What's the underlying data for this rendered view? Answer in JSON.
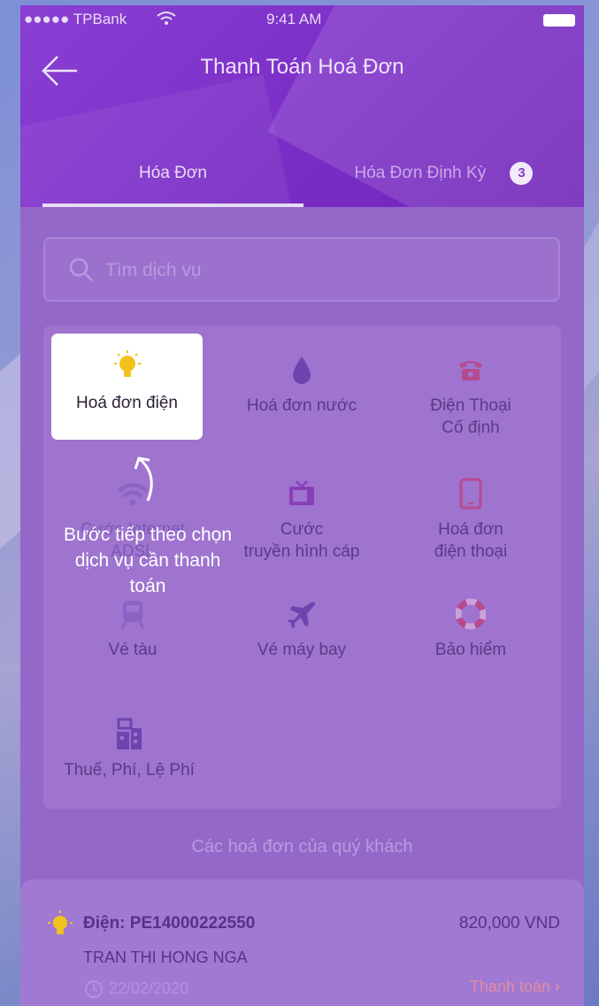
{
  "status_bar": {
    "carrier": "●●●●● TPBank",
    "time": "9:41 AM"
  },
  "header": {
    "title": "Thanh Toán Hoá Đơn",
    "back_icon": "arrow-left-icon"
  },
  "tabs": [
    {
      "label": "Hóa Đơn",
      "active": true
    },
    {
      "label": "Hóa Đơn Định Kỳ",
      "badge": "3",
      "active": false
    }
  ],
  "search": {
    "placeholder": "Tìm dịch vụ",
    "icon": "search-icon"
  },
  "services": [
    {
      "id": "electricity",
      "label": "Hoá đơn điện",
      "icon": "lightbulb-icon",
      "highlighted": true
    },
    {
      "id": "water",
      "label": "Hoá đơn nước",
      "icon": "water-drop-icon"
    },
    {
      "id": "landline",
      "label": "Điện Thoại\nCố định",
      "icon": "telephone-icon"
    },
    {
      "id": "internet",
      "label": "Cước Internet\nADSL",
      "icon": "wifi-icon"
    },
    {
      "id": "cable-tv",
      "label": "Cước\ntruyền hình cáp",
      "icon": "tv-icon"
    },
    {
      "id": "mobile",
      "label": "Hoá đơn\nđiện thoại",
      "icon": "mobile-phone-icon"
    },
    {
      "id": "train",
      "label": "Vé tàu",
      "icon": "train-icon"
    },
    {
      "id": "flight",
      "label": "Vé máy bay",
      "icon": "airplane-icon"
    },
    {
      "id": "insurance",
      "label": "Bảo hiểm",
      "icon": "lifebuoy-icon"
    },
    {
      "id": "tax",
      "label": "Thuế, Phí, Lệ Phí",
      "icon": "building-icon"
    }
  ],
  "coach_mark": {
    "text": "Bước tiếp theo chọn dịch vụ cần thanh toán",
    "icon": "curved-arrow-icon"
  },
  "bills_section": {
    "title": "Các hoá đơn của quý khách"
  },
  "bill": {
    "title": "Điện: PE14000222550",
    "amount": "820,000 VND",
    "customer": "TRAN THI HONG NGA",
    "date": "22/02/2020",
    "pay_label": "Thanh toán",
    "pay_arrow": "›"
  },
  "colors": {
    "header": "#7c2fc7",
    "overlay": "#9468c9",
    "highlight": "#ffffff",
    "accent_yellow": "#f3c21b",
    "pay_link": "#e28aa4"
  }
}
